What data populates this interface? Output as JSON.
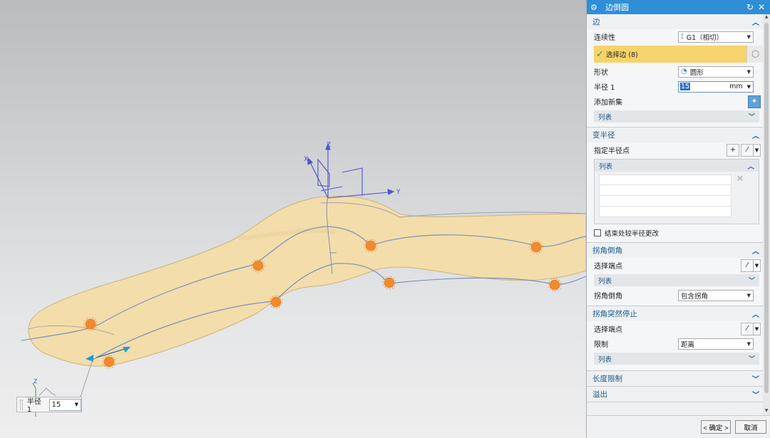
{
  "viewport": {
    "axis_labels": {
      "x": "X",
      "y": "Y",
      "z": "Z"
    },
    "mini_z_label": "Z",
    "mini_radius": {
      "label": "半径 1",
      "value": "15"
    }
  },
  "panel": {
    "title": "边倒圆",
    "edge_section": {
      "heading": "边",
      "continuity_label": "连续性",
      "continuity_value": "G1（相切）",
      "select_edge": "选择边 (8)",
      "shape_label": "形状",
      "shape_value": "圆形",
      "radius_label": "半径 1",
      "radius_value": "15",
      "radius_unit": "mm",
      "add_set_label": "添加新集",
      "list_label": "列表"
    },
    "variable_radius": {
      "heading": "变半径",
      "specify_point_label": "指定半径点",
      "list_label": "列表",
      "checkbox_label": "结束处较半径更改"
    },
    "corner_setback": {
      "heading": "拐角倒角",
      "select_endpoint_label": "选择端点",
      "list_label": "列表",
      "corner_label": "拐角倒角",
      "corner_value": "包含拐角"
    },
    "corner_stop": {
      "heading": "拐角突然停止",
      "select_endpoint_label": "选择端点",
      "limit_label": "限制",
      "limit_value": "距离",
      "list_label": "列表"
    },
    "length_limit": {
      "heading": "长度限制"
    },
    "overflow": {
      "heading": "溢出"
    },
    "ok_label": "< 确定 >",
    "cancel_label": "取消"
  }
}
